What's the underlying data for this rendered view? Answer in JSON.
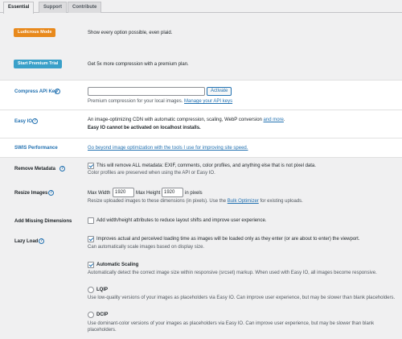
{
  "tabs": [
    "Essential",
    "Support",
    "Contribute"
  ],
  "ludicrous": {
    "button": "Ludicrous Mode",
    "desc": "Show every option possible, even plaid."
  },
  "trial": {
    "button": "Start Premium Trial",
    "desc": "Get 5x more compression with a premium plan."
  },
  "api_key": {
    "label": "Compress API Key",
    "value": "",
    "button": "Activate",
    "desc": "Premium compression for your local images.",
    "link": "Manage your API keys"
  },
  "easy_io": {
    "label": "Easy IO",
    "desc": "An image-optimizing CDN with automatic compression, scaling, WebP conversion",
    "link": "and more",
    "desc_end": ".",
    "warning": "Easy IO cannot be activated on localhost installs."
  },
  "swis": {
    "label": "SWIS Performance",
    "link": "Go beyond image optimization with the tools I use for improving site speed."
  },
  "remove_metadata": {
    "label": "Remove Metadata",
    "text": "This will remove ALL metadata: EXIF, comments, color profiles, and anything else that is not pixel data.",
    "desc": "Color profiles are preserved when using the API or Easy IO.",
    "checked": true
  },
  "resize": {
    "label": "Resize Images",
    "max_width_label": "Max Width",
    "max_width": "1920",
    "max_height_label": "Max Height",
    "max_height": "1920",
    "unit": "in pixels",
    "desc": "Resize uploaded images to these dimensions (in pixels). Use the",
    "link": "Bulk Optimizer",
    "desc_end": "for existing uploads."
  },
  "dimensions": {
    "label": "Add Missing Dimensions",
    "text": "Add width/height attributes to reduce layout shifts and improve user experience.",
    "checked": false
  },
  "lazy": {
    "label": "Lazy Load",
    "text": "Improves actual and perceived loading time as images will be loaded only as they enter (or are about to enter) the viewport.",
    "desc": "Can automatically scale images based on display size.",
    "checked": true
  },
  "auto_scaling": {
    "label": "Automatic Scaling",
    "desc": "Automatically detect the correct image size within responsive (srcset) markup. When used with Easy IO, all images become responsive.",
    "checked": true
  },
  "lqip": {
    "label": "LQIP",
    "desc": "Use low-quality versions of your images as placeholders via Easy IO. Can improve user experience, but may be slower than blank placeholders."
  },
  "dcip": {
    "label": "DCIP",
    "desc": "Use dominant-color versions of your images as placeholders via Easy IO. Can improve user experience, but may be slower than blank placeholders."
  },
  "colors": {
    "accent": "#2271b1",
    "orange": "#e8891c",
    "teal": "#3aa0c9"
  }
}
